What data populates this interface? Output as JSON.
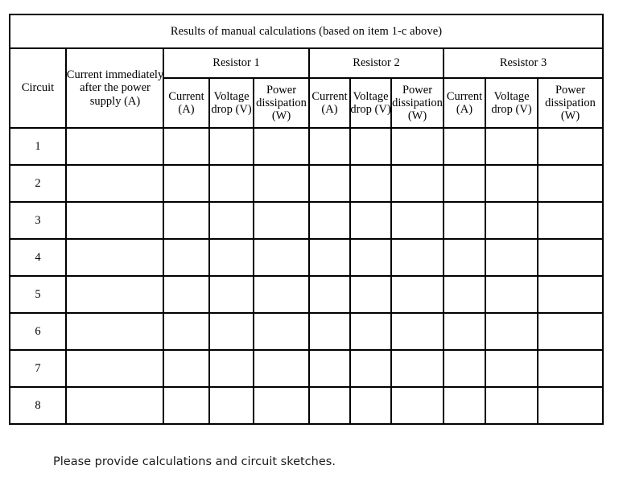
{
  "table": {
    "title": "Results of manual calculations (based on item 1-c above)",
    "stub_headers": {
      "circuit": "Circuit",
      "supply_current": "Current immediately after the power supply (A)"
    },
    "groups": [
      {
        "label": "Resistor 1"
      },
      {
        "label": "Resistor 2"
      },
      {
        "label": "Resistor 3"
      }
    ],
    "sub_headers": {
      "current": "Current (A)",
      "voltage_drop": "Voltage drop (V)",
      "power_dissipation": "Power dissipation (W)"
    },
    "rows": [
      {
        "circuit": "1",
        "supply_current": "",
        "r1_current": "",
        "r1_voltage": "",
        "r1_power": "",
        "r2_current": "",
        "r2_voltage": "",
        "r2_power": "",
        "r3_current": "",
        "r3_voltage": "",
        "r3_power": ""
      },
      {
        "circuit": "2",
        "supply_current": "",
        "r1_current": "",
        "r1_voltage": "",
        "r1_power": "",
        "r2_current": "",
        "r2_voltage": "",
        "r2_power": "",
        "r3_current": "",
        "r3_voltage": "",
        "r3_power": ""
      },
      {
        "circuit": "3",
        "supply_current": "",
        "r1_current": "",
        "r1_voltage": "",
        "r1_power": "",
        "r2_current": "",
        "r2_voltage": "",
        "r2_power": "",
        "r3_current": "",
        "r3_voltage": "",
        "r3_power": ""
      },
      {
        "circuit": "4",
        "supply_current": "",
        "r1_current": "",
        "r1_voltage": "",
        "r1_power": "",
        "r2_current": "",
        "r2_voltage": "",
        "r2_power": "",
        "r3_current": "",
        "r3_voltage": "",
        "r3_power": ""
      },
      {
        "circuit": "5",
        "supply_current": "",
        "r1_current": "",
        "r1_voltage": "",
        "r1_power": "",
        "r2_current": "",
        "r2_voltage": "",
        "r2_power": "",
        "r3_current": "",
        "r3_voltage": "",
        "r3_power": ""
      },
      {
        "circuit": "6",
        "supply_current": "",
        "r1_current": "",
        "r1_voltage": "",
        "r1_power": "",
        "r2_current": "",
        "r2_voltage": "",
        "r2_power": "",
        "r3_current": "",
        "r3_voltage": "",
        "r3_power": ""
      },
      {
        "circuit": "7",
        "supply_current": "",
        "r1_current": "",
        "r1_voltage": "",
        "r1_power": "",
        "r2_current": "",
        "r2_voltage": "",
        "r2_power": "",
        "r3_current": "",
        "r3_voltage": "",
        "r3_power": ""
      },
      {
        "circuit": "8",
        "supply_current": "",
        "r1_current": "",
        "r1_voltage": "",
        "r1_power": "",
        "r2_current": "",
        "r2_voltage": "",
        "r2_power": "",
        "r3_current": "",
        "r3_voltage": "",
        "r3_power": ""
      }
    ]
  },
  "footer": {
    "note": "Please provide calculations and circuit sketches."
  },
  "colors": {
    "border": "#000000",
    "text": "#000000",
    "background": "#ffffff"
  }
}
